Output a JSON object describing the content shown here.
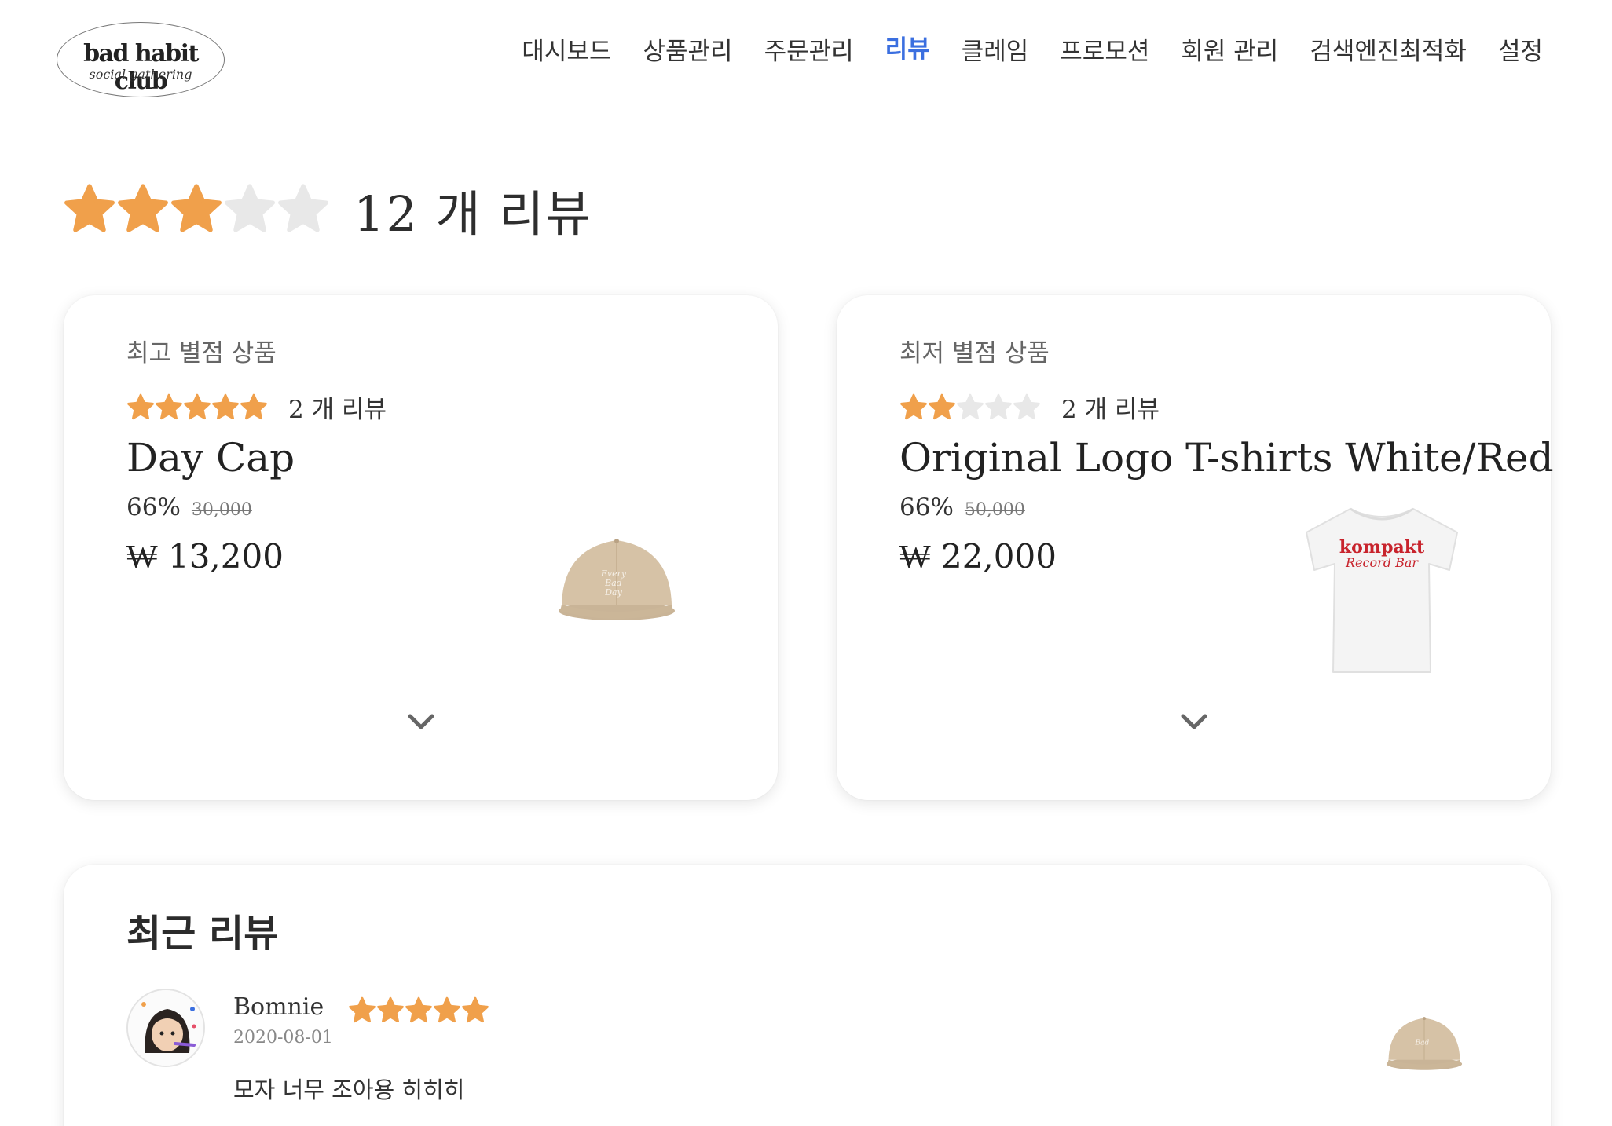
{
  "brand": {
    "name": "bad habit club",
    "tagline": "social gathering"
  },
  "nav": {
    "items": [
      "대시보드",
      "상품관리",
      "주문관리",
      "리뷰",
      "클레임",
      "프로모션",
      "회원 관리",
      "검색엔진최적화",
      "설정"
    ],
    "active": "리뷰"
  },
  "colors": {
    "star_filled": "#f0a04b",
    "star_empty": "#e8e8e8",
    "nav_active": "#3b6fe0"
  },
  "summary": {
    "rating": 3,
    "max_rating": 5,
    "count_text": "12 개 리뷰"
  },
  "best": {
    "label": "최고 별점 상품",
    "rating": 5,
    "review_count": "2 개 리뷰",
    "name": "Day Cap",
    "discount": "66%",
    "original_price": "30,000",
    "price": "₩ 13,200",
    "image_icon": "cap-image"
  },
  "worst": {
    "label": "최저 별점 상품",
    "rating": 2,
    "review_count": "2 개 리뷰",
    "name": "Original Logo T-shirts White/Red",
    "discount": "66%",
    "original_price": "50,000",
    "price": "₩ 22,000",
    "image_icon": "tshirt-image",
    "image_text_1": "kompakt",
    "image_text_2": "Record Bar"
  },
  "recent": {
    "title": "최근 리뷰",
    "reviews": [
      {
        "author": "Bomnie",
        "rating": 5,
        "date": "2020-08-01",
        "text": "모자 너무 조아용 히히히",
        "image_icon": "cap-image"
      }
    ]
  }
}
